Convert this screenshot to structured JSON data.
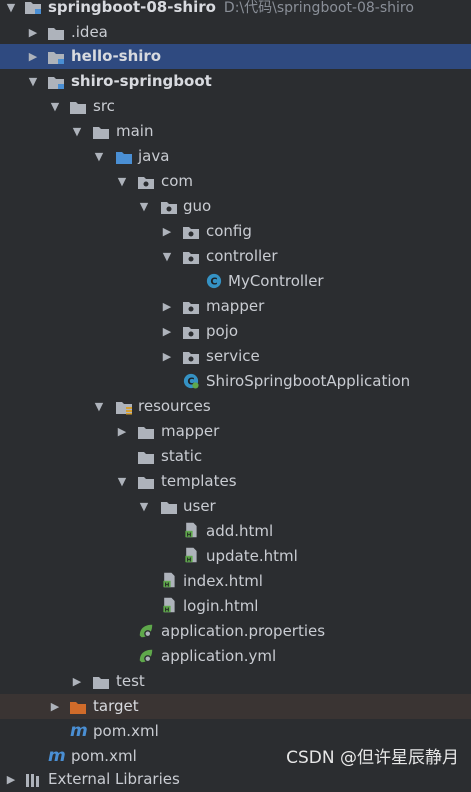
{
  "tree": {
    "root": {
      "label": "springboot-08-shiro",
      "path": "D:\\代码\\springboot-08-shiro"
    },
    "idea": ".idea",
    "hello_shiro": "hello-shiro",
    "shiro_springboot": "shiro-springboot",
    "src": "src",
    "main": "main",
    "java": "java",
    "com": "com",
    "guo": "guo",
    "config": "config",
    "controller": "controller",
    "my_controller": "MyController",
    "mapper": "mapper",
    "pojo": "pojo",
    "service": "service",
    "app_class": "ShiroSpringbootApplication",
    "resources": "resources",
    "res_mapper": "mapper",
    "static": "static",
    "templates": "templates",
    "user": "user",
    "add_html": "add.html",
    "update_html": "update.html",
    "index_html": "index.html",
    "login_html": "login.html",
    "app_properties": "application.properties",
    "app_yml": "application.yml",
    "test": "test",
    "target": "target",
    "pom_inner": "pom.xml",
    "pom_root": "pom.xml",
    "external": "External Libraries"
  },
  "watermark": "CSDN @但许星辰静月",
  "colors": {
    "background": "#2b2d30",
    "selection": "#2f4a80",
    "folder": "#aeb3bb",
    "source_folder": "#4a8fd4",
    "excluded_folder": "#d06b2a",
    "class_icon": "#3592c4",
    "html_icon": "#5fa84b"
  }
}
